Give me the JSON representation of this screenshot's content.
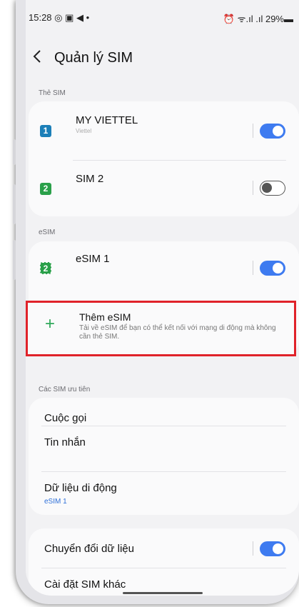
{
  "status_bar": {
    "time": "15:28 ◎ ▣ ◀ •",
    "right": "⏰ ᯤ.ıl .ıl 29%▬"
  },
  "header": {
    "back_icon": "chevron-left-icon",
    "title": "Quản lý SIM"
  },
  "sim_cards": {
    "section_label": "Thẻ SIM",
    "items": [
      {
        "badge": "1",
        "badge_color": "#1c7fb8",
        "name": "MY VIETTEL",
        "sub": "Viettel",
        "enabled": true
      },
      {
        "badge": "2",
        "badge_color": "#2aa04a",
        "name": "SIM 2",
        "enabled": false
      }
    ]
  },
  "esim": {
    "section_label": "eSIM",
    "items": [
      {
        "badge": "2",
        "badge_color": "#2aa04a",
        "name": "eSIM 1",
        "enabled": true
      }
    ],
    "add": {
      "title": "Thêm eSIM",
      "description": "Tải về eSIM để bạn có thể kết nối với mạng di động mà không cần thẻ SIM."
    }
  },
  "preferred": {
    "section_label": "Các SIM ưu tiên",
    "items": [
      {
        "title": "Cuộc gọi"
      },
      {
        "title": "Tin nhắn"
      },
      {
        "title": "Dữ liệu di động",
        "sub": "eSIM 1"
      }
    ]
  },
  "other": {
    "data_switch": {
      "title": "Chuyển đổi dữ liệu",
      "enabled": true
    },
    "more_settings": {
      "title": "Cài đặt SIM khác"
    }
  }
}
